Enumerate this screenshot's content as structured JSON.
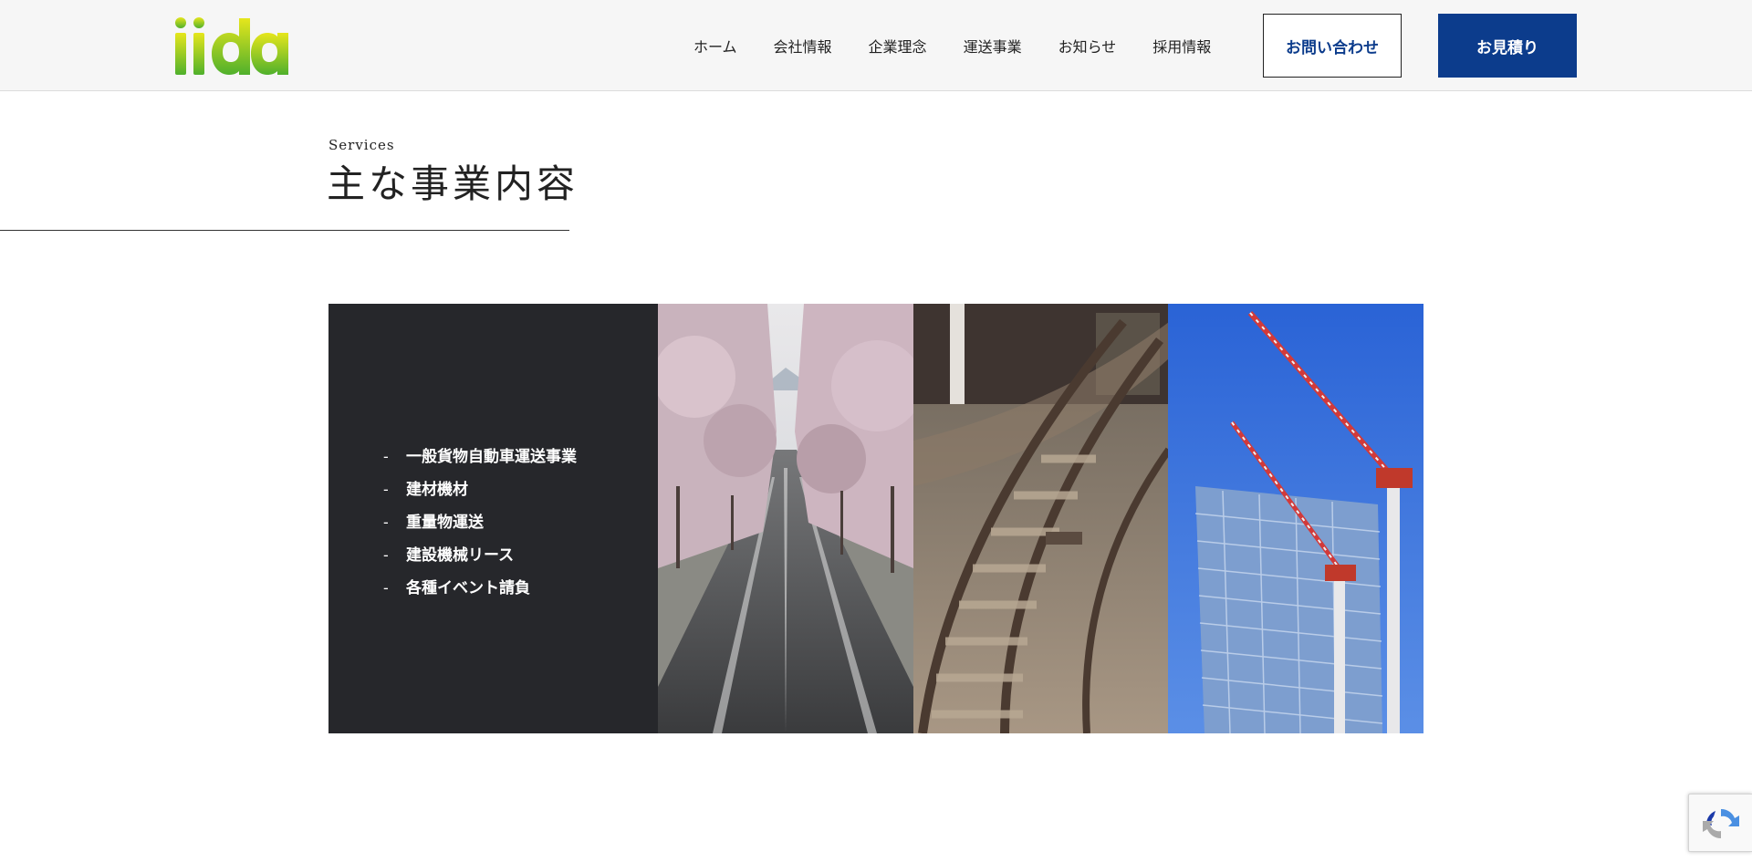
{
  "header": {
    "logo_text": "iida",
    "nav": [
      {
        "label": "ホーム"
      },
      {
        "label": "会社情報"
      },
      {
        "label": "企業理念"
      },
      {
        "label": "運送事業"
      },
      {
        "label": "お知らせ"
      },
      {
        "label": "採用情報"
      }
    ],
    "contact_label": "お問い合わせ",
    "estimate_label": "お見積り"
  },
  "services": {
    "eyebrow": "Services",
    "title": "主な事業内容",
    "items": [
      {
        "dash": "-",
        "label": "一般貨物自動車運送事業"
      },
      {
        "dash": "-",
        "label": "建材機材"
      },
      {
        "dash": "-",
        "label": "重量物運送"
      },
      {
        "dash": "-",
        "label": "建設機械リース"
      },
      {
        "dash": "-",
        "label": "各種イベント請負"
      }
    ]
  },
  "colors": {
    "brand_navy": "#0c3c8c",
    "logo_yellow": "#d6e01a",
    "logo_green": "#5cb82e",
    "panel_dark": "#26272b"
  },
  "icons": [
    "recaptcha-icon"
  ]
}
